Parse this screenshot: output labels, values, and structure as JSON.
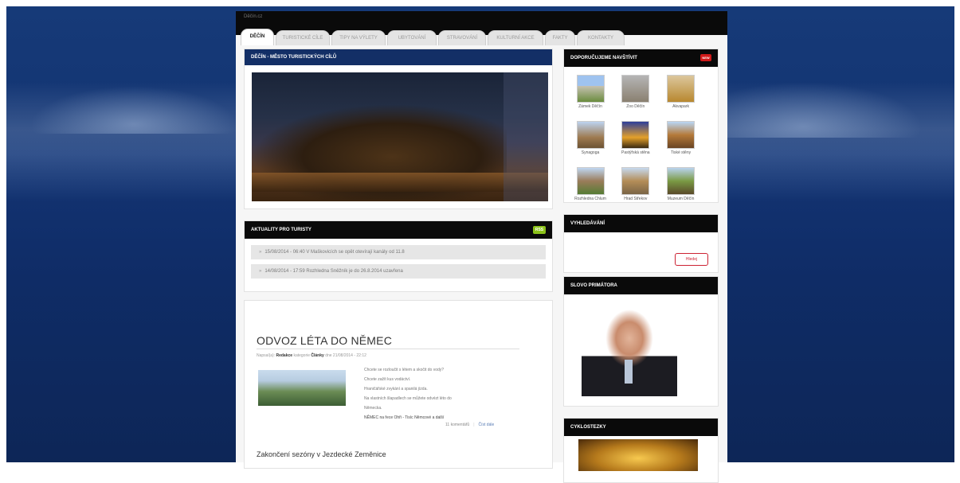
{
  "topbar": {
    "small_text": "Děčín.cz"
  },
  "nav": {
    "tabs": [
      {
        "label": "Děčín"
      },
      {
        "label": "Turistické cíle"
      },
      {
        "label": "Tipy na výlety"
      },
      {
        "label": "Ubytování"
      },
      {
        "label": "Stravování"
      },
      {
        "label": "Kulturní akce"
      },
      {
        "label": "Fakty"
      },
      {
        "label": "Kontakty"
      }
    ]
  },
  "hero": {
    "title": "Děčín - město turistických cílů"
  },
  "news": {
    "title": "Aktuality pro turisty",
    "badge": "RSS",
    "items": [
      {
        "text": "15/08/2014 - 06:40 V Maškovicích se opět otevírají kanály od 11.8"
      },
      {
        "text": "14/08/2014 - 17:59 Rozhledna Sněžník je do 26.8.2014 uzavřena"
      }
    ]
  },
  "article": {
    "title": "ODVOZ LÉTA DO NĚMEC",
    "meta_prefix": "Napsal(a):",
    "author": "Redakce",
    "meta_category_prefix": "kategorie",
    "category": "Články",
    "meta_date": "dne 21/08/2014 - 22:12",
    "lines": [
      "Chcete se rozloučit s létem a skočit do vody?",
      "Chcete zažít kus vodáctví.",
      "Hraničářské zvykání a spanilá jízda.",
      "Na vlastních šlapadlech se můžete odvézt léto do",
      "Německa.",
      "NĚMEC na řece Ohři - Tisíc Němcové a další"
    ],
    "comments": "11 komentářů",
    "read_more": "Číst dále",
    "next_title": "Zakončení sezóny v Jezdecké Zeměnice"
  },
  "recommended": {
    "title": "Doporučujeme navštívit",
    "badge": "NEW",
    "items": [
      {
        "label": "Zámek Děčín"
      },
      {
        "label": "Zoo Děčín"
      },
      {
        "label": "Akvapark"
      },
      {
        "label": "Synagoga"
      },
      {
        "label": "Pastýřská stěna"
      },
      {
        "label": "Tiské stěny"
      },
      {
        "label": "Rozhledna Chlum"
      },
      {
        "label": "Hrad Střekov"
      },
      {
        "label": "Muzeum Děčín"
      }
    ]
  },
  "search": {
    "title": "Vyhledávání",
    "button": "Hledej"
  },
  "mayor": {
    "title": "Slovo primátora"
  },
  "city": {
    "title": "Cyklostezky"
  }
}
